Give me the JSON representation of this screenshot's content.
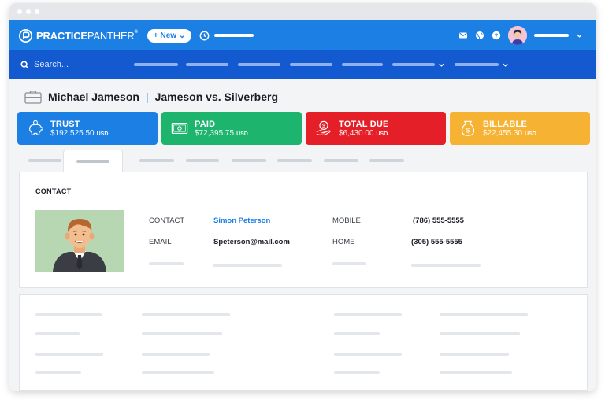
{
  "app": {
    "brand_bold": "PRACTICE",
    "brand_thin": "PANTHER",
    "brand_tm": "®",
    "new_button": "+ New",
    "new_caret": "⌄"
  },
  "search": {
    "placeholder": "Search..."
  },
  "case": {
    "client": "Michael Jameson",
    "separator": "|",
    "matter": "Jameson vs. Silverberg"
  },
  "cards": [
    {
      "title": "TRUST",
      "amount": "$192,525.50",
      "currency": "USD",
      "color": "#1b7fe4",
      "icon": "piggy-bank-icon"
    },
    {
      "title": "PAID",
      "amount": "$72,395.75",
      "currency": "USD",
      "color": "#1db56e",
      "icon": "banknote-icon"
    },
    {
      "title": "TOTAL DUE",
      "amount": "$6,430.00",
      "currency": "USD",
      "color": "#e51f28",
      "icon": "money-hand-icon"
    },
    {
      "title": "BILLABLE",
      "amount": "$22,455.30",
      "currency": "USD",
      "color": "#f5b233",
      "icon": "money-bag-icon"
    }
  ],
  "contact": {
    "section_title": "CONTACT",
    "fields": [
      {
        "label": "CONTACT",
        "value": "Simon Peterson"
      },
      {
        "label": "EMAIL",
        "value": "Speterson@mail.com"
      },
      {
        "label": "MOBILE",
        "value": "(786) 555-5555"
      },
      {
        "label": "HOME",
        "value": "(305) 555-5555"
      }
    ]
  },
  "icons": {
    "topbar": [
      "mail-icon",
      "globe-icon",
      "help-icon",
      "avatar",
      "chevron-down-icon"
    ],
    "nav": [
      "search-icon",
      "chevron-down-icon"
    ]
  }
}
